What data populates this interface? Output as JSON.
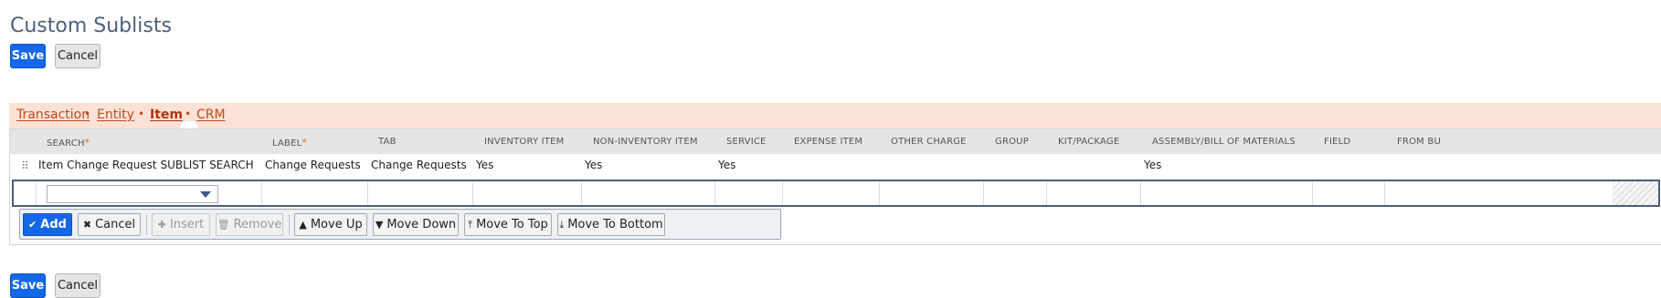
{
  "page": {
    "title": "Custom Sublists"
  },
  "top_buttons": {
    "save": "Save",
    "cancel": "Cancel"
  },
  "tabs": [
    {
      "label": "Transaction",
      "dot": "•"
    },
    {
      "label": "Entity",
      "dot": "•"
    },
    {
      "label": "Item",
      "dot": "•"
    },
    {
      "label": "CRM",
      "dot": ""
    }
  ],
  "columns": {
    "search": "SEARCH",
    "label": "LABEL",
    "tab": "TAB",
    "inventory_item": "INVENTORY ITEM",
    "non_inventory_item": "NON-INVENTORY ITEM",
    "service": "SERVICE",
    "expense_item": "EXPENSE ITEM",
    "other_charge": "OTHER CHARGE",
    "group": "GROUP",
    "kit_package": "KIT/PACKAGE",
    "assembly": "ASSEMBLY/BILL OF MATERIALS",
    "field": "FIELD",
    "from_bu": "FROM BU"
  },
  "required_marker": "*",
  "row": {
    "search": "Item Change Request SUBLIST SEARCH",
    "label": "Change Requests",
    "tab": "Change Requests",
    "inventory_item": "Yes",
    "non_inventory_item": "Yes",
    "service": "Yes",
    "assembly": "Yes"
  },
  "actions": {
    "add": "Add",
    "cancel": "Cancel",
    "insert": "Insert",
    "remove": "Remove",
    "move_up": "Move Up",
    "move_down": "Move Down",
    "move_to_top": "Move To Top",
    "move_to_bottom": "Move To Bottom"
  },
  "bottom_buttons": {
    "save": "Save",
    "cancel": "Cancel"
  },
  "icons": {
    "add": "check-icon",
    "cancel": "x-icon",
    "insert": "plus-icon",
    "remove": "trash-icon",
    "move_up": "triangle-up-icon",
    "move_down": "triangle-down-icon",
    "move_to_top": "arrow-to-top-icon",
    "move_to_bottom": "arrow-to-bottom-icon"
  },
  "colors": {
    "primary": "#1467e8",
    "tab_bar": "#fbe2d6",
    "tab_text": "#c24a1c",
    "title": "#4d5f79"
  }
}
